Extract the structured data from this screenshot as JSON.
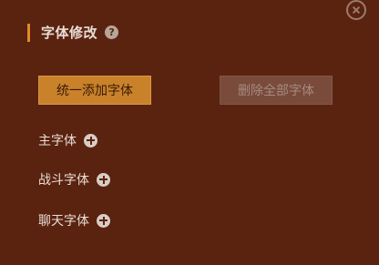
{
  "header": {
    "title": "字体修改",
    "help_glyph": "?"
  },
  "actions": {
    "add_all_label": "统一添加字体",
    "delete_all_label": "删除全部字体"
  },
  "font_rows": [
    {
      "label": "主字体",
      "icon": "plus-circle-icon"
    },
    {
      "label": "战斗字体",
      "icon": "plus-circle-icon"
    },
    {
      "label": "聊天字体",
      "icon": "plus-circle-icon"
    }
  ],
  "colors": {
    "background": "#5a2310",
    "accent": "#e08a2a",
    "primary_button": "#c9822a",
    "disabled_button": "#7a4b3b"
  }
}
